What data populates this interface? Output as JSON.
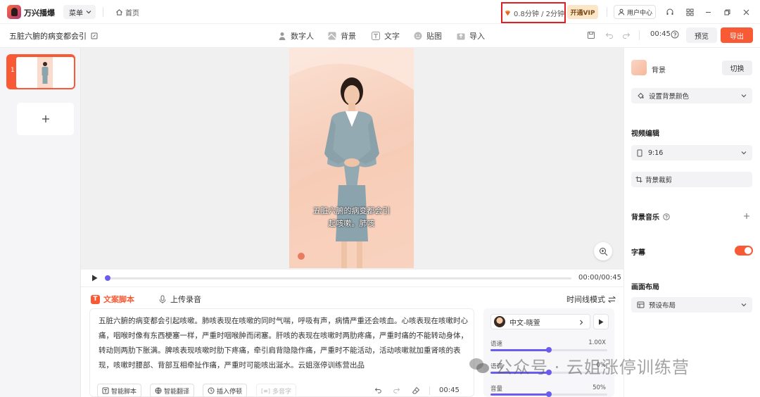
{
  "app": {
    "name": "万兴播爆"
  },
  "titlebar": {
    "menu_label": "菜单",
    "home_label": "首页",
    "quota_text": "0.8分钟 / 2分钟",
    "vip_label": "开通VIP",
    "user_center_label": "用户中心"
  },
  "project": {
    "title": "五脏六腑的病变都会引",
    "tools": [
      {
        "label": "数字人",
        "icon": "digital-human-icon"
      },
      {
        "label": "背景",
        "icon": "background-icon"
      },
      {
        "label": "文字",
        "icon": "text-icon"
      },
      {
        "label": "贴图",
        "icon": "sticker-icon"
      },
      {
        "label": "导入",
        "icon": "import-icon"
      }
    ],
    "duration": "00:45",
    "preview_label": "预览",
    "export_label": "导出"
  },
  "slides": [
    {
      "number": "1"
    }
  ],
  "canvas": {
    "subtitle_line1": "五脏六腑的病变都会引",
    "subtitle_line2": "起咳嗽。肺咳"
  },
  "player": {
    "time": "00:00/00:45",
    "progress": 0
  },
  "script": {
    "tab_script": "文案脚本",
    "tab_upload": "上传录音",
    "mode_label": "时间线模式",
    "text": "五脏六腑的病变都会引起咳嗽。肺咳表现在咳嗽的同时气喘，呼吸有声，病情严重还会咳血。心咳表现在咳嗽时心痛，咽喉时像有东西梗塞一样，严重时咽喉肿而闭塞。肝咳的表现在咳嗽时两肋疼痛，严重时痛的不能转动身体，转动则两肋下胀满。脾咳表现咳嗽时肋下疼痛，牵引肩背隐隐作痛，严重时不能活动，活动咳嗽就加重肾咳的表现，咳嗽时腰部、背部互相牵扯作痛，严重时可能咳出涎水。云姐涨停训练营出品",
    "btn_smart_script": "智能脚本",
    "btn_smart_translate": "智能翻译",
    "btn_insert_pause": "插入停顿",
    "btn_polyphone": "多音字",
    "duration": "00:45"
  },
  "voice": {
    "name": "中文-晓萱",
    "speed_label": "语速",
    "speed_value": "1.00X",
    "speed_level": 0.5,
    "pitch_label": "语调",
    "pitch_value": "0%",
    "pitch_level": 0.5,
    "volume_label": "音量",
    "volume_value": "50%",
    "volume_level": 0.5
  },
  "right_panel": {
    "background_label": "背景",
    "switch_label": "切换",
    "bg_color_label": "设置背景颜色",
    "video_edit_heading": "视频编辑",
    "ratio_value": "9:16",
    "crop_label": "背景裁剪",
    "music_heading": "背景音乐",
    "subtitle_heading": "字幕",
    "subtitle_enabled": true,
    "layout_heading": "画面布局",
    "layout_value": "预设布局"
  },
  "watermark": "公众号 · 云姐涨停训练营",
  "colors": {
    "accent": "#f75a35",
    "slider": "#6a5cf0",
    "highlight_border": "#e02020"
  }
}
